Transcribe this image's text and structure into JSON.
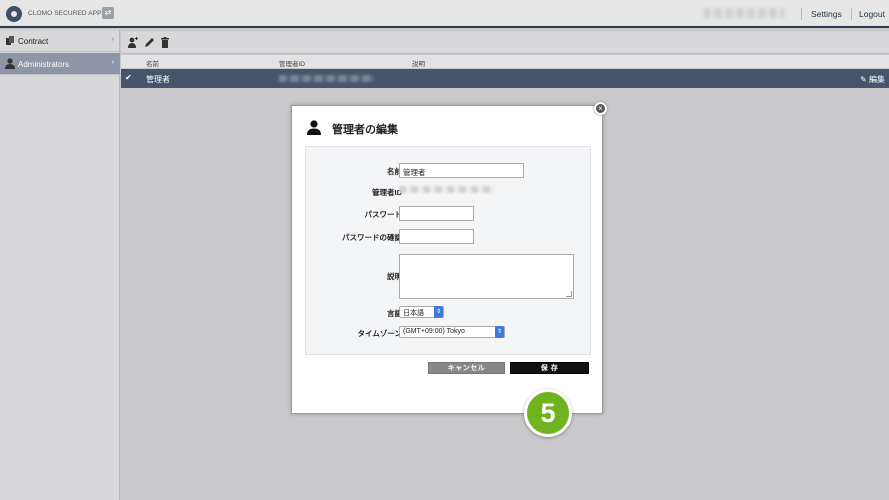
{
  "header": {
    "app_name": "CLOMO SECURED APPs",
    "settings_label": "Settings",
    "logout_label": "Logout"
  },
  "sidebar": {
    "items": [
      {
        "label": "Contract",
        "chevron": "›"
      },
      {
        "label": "Administrators",
        "chevron": "›"
      }
    ]
  },
  "table": {
    "columns": [
      "名前",
      "管理者ID",
      "説明"
    ],
    "rows": [
      {
        "check": "✔",
        "name": "管理者",
        "edit_label": "✎ 編集"
      }
    ]
  },
  "modal": {
    "title": "管理者の編集",
    "close_glyph": "×",
    "fields": {
      "name_label": "名前",
      "name_value": "管理者",
      "id_label": "管理者ID",
      "password_label": "パスワード",
      "password_confirm_label": "パスワードの確認",
      "description_label": "説明",
      "language_label": "言語",
      "language_value": "日本語",
      "timezone_label": "タイムゾーン",
      "timezone_value": "(GMT+09:00) Tokyo"
    },
    "cancel_label": "キャンセル",
    "save_label": "保 存"
  },
  "annotation": {
    "step_number": "5"
  },
  "colors": {
    "accent_navy": "#2b3a4e",
    "selected_row": "#46556b",
    "step_green": "#6fb31e",
    "select_blue": "#3e7bde"
  }
}
